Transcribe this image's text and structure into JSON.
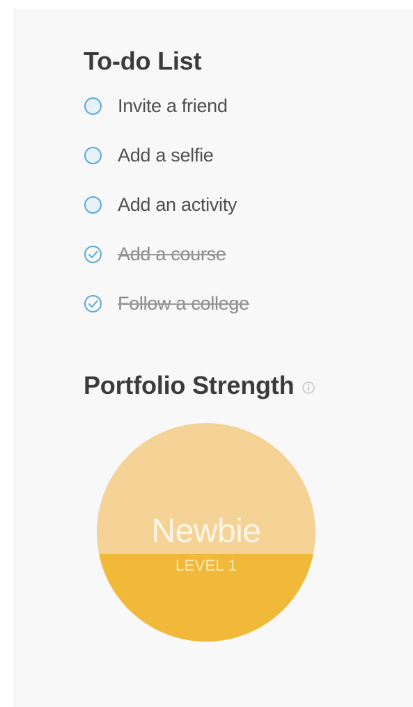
{
  "todo": {
    "title": "To-do List",
    "items": [
      {
        "label": "Invite a friend",
        "done": false
      },
      {
        "label": "Add a selfie",
        "done": false
      },
      {
        "label": "Add an activity",
        "done": false
      },
      {
        "label": "Add a course",
        "done": true
      },
      {
        "label": "Follow a college",
        "done": true
      }
    ]
  },
  "strength": {
    "title": "Portfolio Strength",
    "info_icon": "info-icon",
    "level_name": "Newbie",
    "level_number": "LEVEL 1",
    "fill_fraction": 0.4
  },
  "colors": {
    "panel_bg": "#f8f8f8",
    "check_blue": "#5aa9d6",
    "circle_light": "#f5d397",
    "circle_fill": "#f0b93a"
  }
}
